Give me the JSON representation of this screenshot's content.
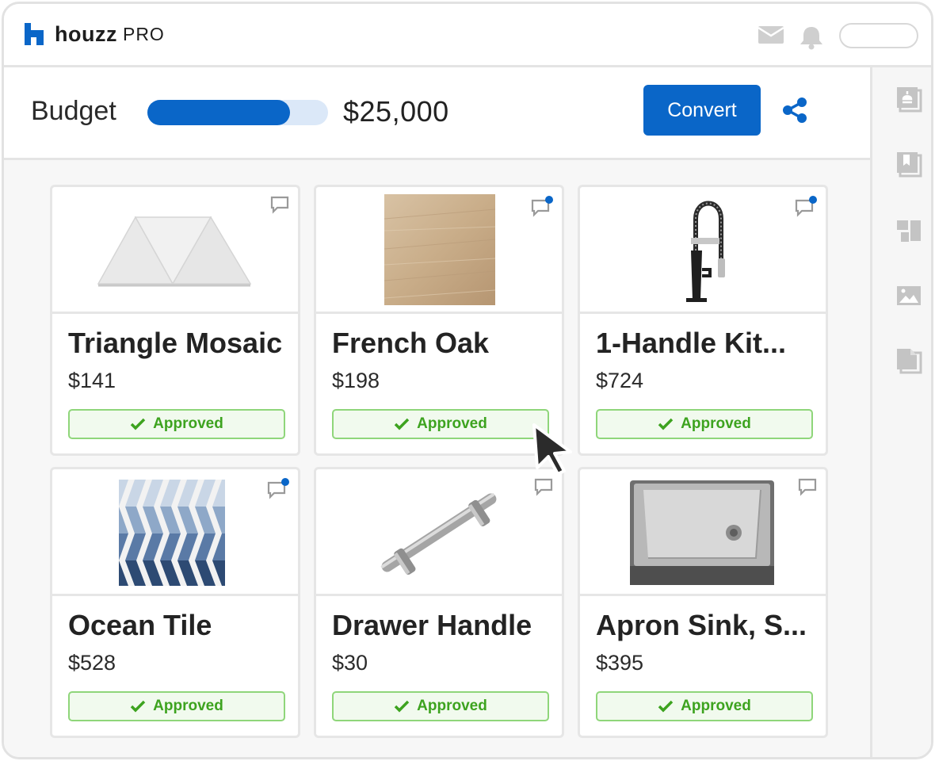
{
  "app": {
    "brand": "houzz",
    "brand_suffix": "PRO"
  },
  "header": {
    "icons": [
      "mail-icon",
      "bell-icon"
    ]
  },
  "budget": {
    "label": "Budget",
    "amount": "$25,000",
    "progress_fraction": 0.79
  },
  "toolbar": {
    "convert_label": "Convert"
  },
  "sidebar": {
    "icons": [
      "estimate-icon",
      "book-icon",
      "layout-icon",
      "image-icon",
      "document-icon"
    ]
  },
  "products": [
    {
      "title": "Triangle Mosaic",
      "price": "$141",
      "status": "Approved",
      "has_new_comment": false
    },
    {
      "title": "French Oak",
      "price": "$198",
      "status": "Approved",
      "has_new_comment": true
    },
    {
      "title": "1-Handle Kit...",
      "price": "$724",
      "status": "Approved",
      "has_new_comment": true
    },
    {
      "title": "Ocean Tile",
      "price": "$528",
      "status": "Approved",
      "has_new_comment": true
    },
    {
      "title": "Drawer Handle",
      "price": "$30",
      "status": "Approved",
      "has_new_comment": false
    },
    {
      "title": "Apron Sink, S...",
      "price": "$395",
      "status": "Approved",
      "has_new_comment": false
    }
  ],
  "colors": {
    "accent": "#0a66c8",
    "approved": "#3da31f",
    "approved_bg": "#f1faee"
  }
}
